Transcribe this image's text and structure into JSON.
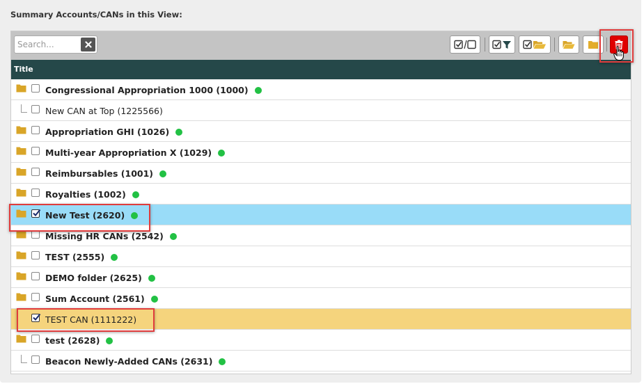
{
  "section_title": "Summary Accounts/CANs in this View:",
  "search": {
    "placeholder": "Search..."
  },
  "icons": {
    "clear": "close-icon",
    "toggle_select": "check-square-toggle-icon",
    "filter_checked": "check-filter-icon",
    "check_open_folder": "check-open-folder-icon",
    "open_folder": "open-folder-icon",
    "folder": "folder-icon",
    "delete": "trash-icon"
  },
  "colors": {
    "header_bg": "#254849",
    "selected_blue": "#99dcf8",
    "selected_yellow": "#f5d47d",
    "status_dot": "#22c144",
    "delete_red": "#e00000",
    "folder": "#d9a528"
  },
  "table": {
    "column_title": "Title",
    "rows": [
      {
        "label": "Congressional Appropriation 1000 (1000)",
        "type": "folder",
        "checked": false,
        "status": true
      },
      {
        "label": "New CAN at Top (1225566)",
        "type": "can",
        "checked": false,
        "status": false
      },
      {
        "label": "Appropriation GHI (1026)",
        "type": "folder",
        "checked": false,
        "status": true
      },
      {
        "label": "Multi-year Appropriation X (1029)",
        "type": "folder",
        "checked": false,
        "status": true
      },
      {
        "label": "Reimbursables (1001)",
        "type": "folder",
        "checked": false,
        "status": true
      },
      {
        "label": "Royalties (1002)",
        "type": "folder",
        "checked": false,
        "status": true
      },
      {
        "label": "New Test (2620)",
        "type": "folder",
        "checked": true,
        "status": true
      },
      {
        "label": "Missing HR CANs (2542)",
        "type": "folder",
        "checked": false,
        "status": true
      },
      {
        "label": "TEST (2555)",
        "type": "folder",
        "checked": false,
        "status": true
      },
      {
        "label": "DEMO folder (2625)",
        "type": "folder",
        "checked": false,
        "status": true
      },
      {
        "label": "Sum Account (2561)",
        "type": "folder",
        "checked": false,
        "status": true
      },
      {
        "label": "TEST CAN (1111222)",
        "type": "can",
        "checked": true,
        "status": false
      },
      {
        "label": "test (2628)",
        "type": "folder",
        "checked": false,
        "status": true
      },
      {
        "label": "Beacon Newly-Added CANs (2631)",
        "type": "child",
        "checked": false,
        "status": true
      }
    ]
  }
}
